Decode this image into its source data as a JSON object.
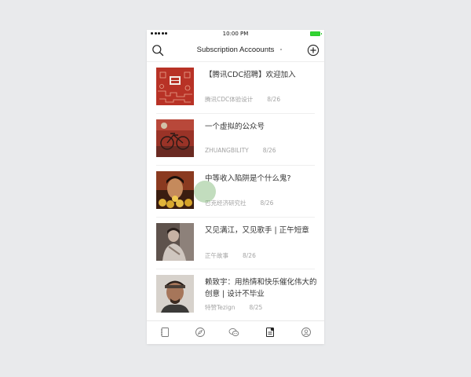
{
  "status_bar": {
    "time": "10:00 PM",
    "battery_color": "#33d433"
  },
  "header": {
    "title": "Subscription Accoounts",
    "left_icon": "search-icon",
    "right_icon": "add-circle-icon"
  },
  "articles": [
    {
      "title": "【腾讯CDC招聘】欢迎加入",
      "source": "腾讯CDC体验设计",
      "date": "8/26",
      "thumb": "cdc-recruit-image"
    },
    {
      "title": "一个虚拟的公众号",
      "source": "ZHUANGBILITY",
      "date": "8/26",
      "thumb": "red-bicycle-image"
    },
    {
      "title": "中等收入陷阱是个什么鬼?",
      "source": "巴克经济研究社",
      "date": "8/26",
      "thumb": "face-with-coins-image"
    },
    {
      "title": "又见满江，又见歌手 | 正午短章",
      "source": "正午故事",
      "date": "8/26",
      "thumb": "singer-portrait-image"
    },
    {
      "title": "赖致宇：用热情和快乐催化伟大的创意 | 设计不毕业",
      "source": "特赞Tezign",
      "date": "8/25",
      "thumb": "man-portrait-image"
    }
  ],
  "tabbar": {
    "tabs": [
      {
        "icon": "notebook-icon"
      },
      {
        "icon": "compass-icon"
      },
      {
        "icon": "chat-bubbles-icon"
      },
      {
        "icon": "article-list-icon",
        "active": true
      },
      {
        "icon": "profile-icon"
      }
    ]
  },
  "colors": {
    "background": "#e9eaec",
    "title_text": "#333333",
    "meta_text": "#a3a3a3",
    "touch_indicator": "#78b46e"
  }
}
